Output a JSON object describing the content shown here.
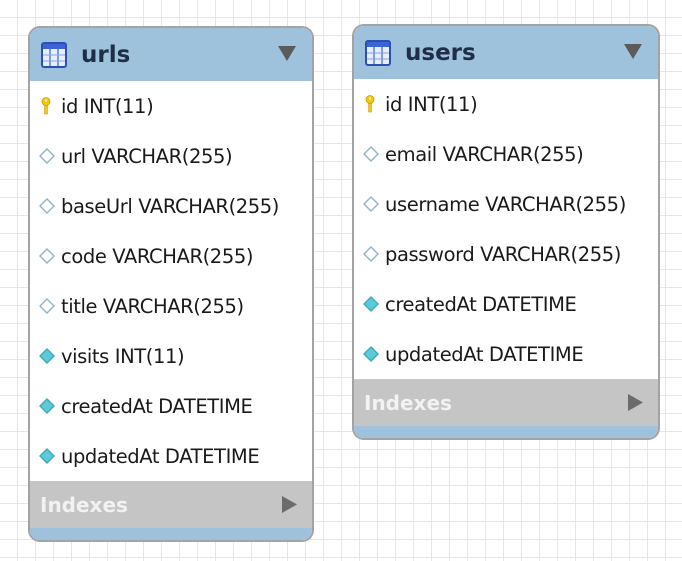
{
  "tables": [
    {
      "name": "urls",
      "columns": [
        {
          "text": "id INT(11)",
          "icon": "key-icon"
        },
        {
          "text": "url VARCHAR(255)",
          "icon": "column-diamond-icon"
        },
        {
          "text": "baseUrl VARCHAR(255)",
          "icon": "column-diamond-icon"
        },
        {
          "text": "code VARCHAR(255)",
          "icon": "column-diamond-icon"
        },
        {
          "text": "title VARCHAR(255)",
          "icon": "column-diamond-icon"
        },
        {
          "text": "visits INT(11)",
          "icon": "column-diamond-filled-icon"
        },
        {
          "text": "createdAt DATETIME",
          "icon": "column-diamond-filled-icon"
        },
        {
          "text": "updatedAt DATETIME",
          "icon": "column-diamond-filled-icon"
        }
      ],
      "indexes_label": "Indexes"
    },
    {
      "name": "users",
      "columns": [
        {
          "text": "id INT(11)",
          "icon": "key-icon"
        },
        {
          "text": "email VARCHAR(255)",
          "icon": "column-diamond-icon"
        },
        {
          "text": "username VARCHAR(255)",
          "icon": "column-diamond-icon"
        },
        {
          "text": "password VARCHAR(255)",
          "icon": "column-diamond-icon"
        },
        {
          "text": "createdAt DATETIME",
          "icon": "column-diamond-filled-icon"
        },
        {
          "text": "updatedAt DATETIME",
          "icon": "column-diamond-filled-icon"
        }
      ],
      "indexes_label": "Indexes"
    }
  ],
  "colors": {
    "header": "#9fc2dc",
    "indexes_bar": "#c5c5c5",
    "key": "#f2c811",
    "diamond_outline": "#8fb4c7",
    "diamond_filled": "#5ec9d8"
  }
}
